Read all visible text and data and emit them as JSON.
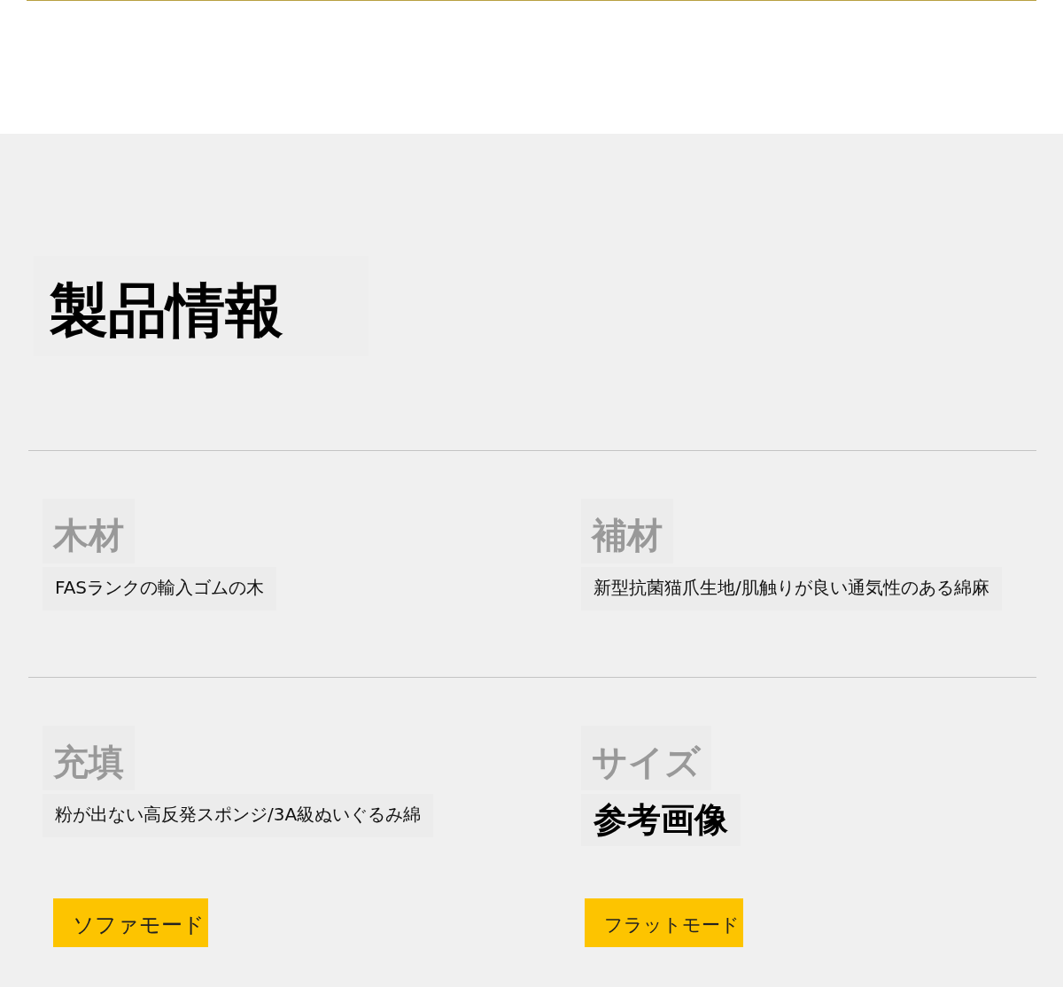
{
  "title": "製品情報",
  "specs": [
    {
      "label": "木材",
      "value": "FASランクの輸入ゴムの木",
      "kind": "plain"
    },
    {
      "label": "補材",
      "value": "新型抗菌猫爪生地/肌触りが良い通気性のある綿麻",
      "kind": "plain"
    },
    {
      "label": "充填",
      "value": "粉が出ない高反発スポンジ/3A級ぬいぐるみ綿",
      "kind": "plain"
    },
    {
      "label": "サイズ",
      "value": "参考画像",
      "kind": "emphasis"
    }
  ],
  "modes": [
    {
      "label": "ソファモード"
    },
    {
      "label": "フラットモード"
    }
  ]
}
